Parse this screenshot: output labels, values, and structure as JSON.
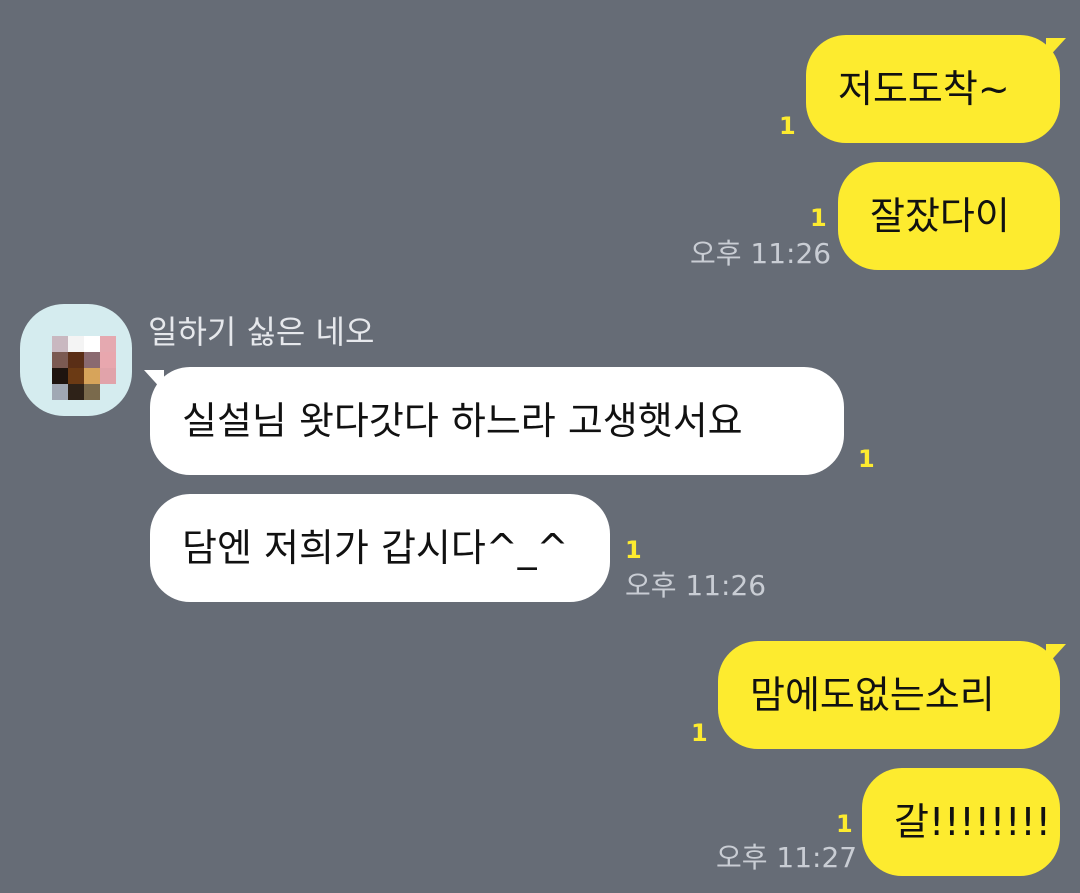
{
  "chat": {
    "messages": [
      {
        "side": "mine",
        "text": "저도도착~",
        "unread": "1"
      },
      {
        "side": "mine",
        "text": "잘잤다이",
        "unread": "1",
        "time": "오후 11:26"
      },
      {
        "side": "theirs",
        "sender": "일하기 싫은 네오",
        "text": "실설님 왓다갓다 하느라 고생햇서요",
        "unread": "1"
      },
      {
        "side": "theirs",
        "text": "담엔 저희가 갑시다^_^",
        "unread": "1",
        "time": "오후 11:26"
      },
      {
        "side": "mine",
        "text": "맘에도없는소리",
        "unread": "1"
      },
      {
        "side": "mine",
        "text": "갈!!!!!!!!",
        "unread": "1",
        "time": "오후 11:27"
      }
    ]
  },
  "colors": {
    "background": "#666c76",
    "my_bubble": "#fdeb2f",
    "their_bubble": "#ffffff",
    "unread_count": "#fdeb2f",
    "timestamp": "#c9cdd4"
  }
}
